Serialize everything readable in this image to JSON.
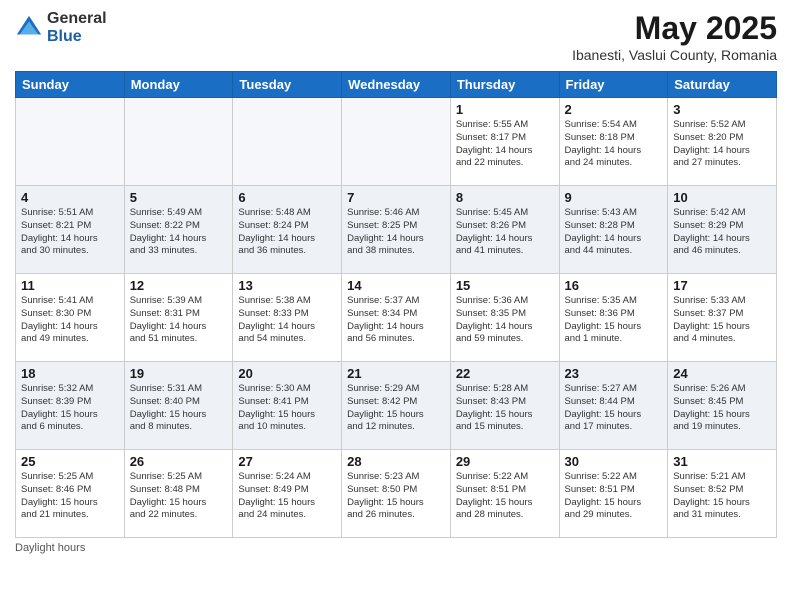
{
  "logo": {
    "general": "General",
    "blue": "Blue"
  },
  "header": {
    "month": "May 2025",
    "location": "Ibanesti, Vaslui County, Romania"
  },
  "days": [
    "Sunday",
    "Monday",
    "Tuesday",
    "Wednesday",
    "Thursday",
    "Friday",
    "Saturday"
  ],
  "footer": {
    "note": "Daylight hours"
  },
  "weeks": [
    [
      {
        "day": "",
        "content": ""
      },
      {
        "day": "",
        "content": ""
      },
      {
        "day": "",
        "content": ""
      },
      {
        "day": "",
        "content": ""
      },
      {
        "day": "1",
        "content": "Sunrise: 5:55 AM\nSunset: 8:17 PM\nDaylight: 14 hours\nand 22 minutes."
      },
      {
        "day": "2",
        "content": "Sunrise: 5:54 AM\nSunset: 8:18 PM\nDaylight: 14 hours\nand 24 minutes."
      },
      {
        "day": "3",
        "content": "Sunrise: 5:52 AM\nSunset: 8:20 PM\nDaylight: 14 hours\nand 27 minutes."
      }
    ],
    [
      {
        "day": "4",
        "content": "Sunrise: 5:51 AM\nSunset: 8:21 PM\nDaylight: 14 hours\nand 30 minutes."
      },
      {
        "day": "5",
        "content": "Sunrise: 5:49 AM\nSunset: 8:22 PM\nDaylight: 14 hours\nand 33 minutes."
      },
      {
        "day": "6",
        "content": "Sunrise: 5:48 AM\nSunset: 8:24 PM\nDaylight: 14 hours\nand 36 minutes."
      },
      {
        "day": "7",
        "content": "Sunrise: 5:46 AM\nSunset: 8:25 PM\nDaylight: 14 hours\nand 38 minutes."
      },
      {
        "day": "8",
        "content": "Sunrise: 5:45 AM\nSunset: 8:26 PM\nDaylight: 14 hours\nand 41 minutes."
      },
      {
        "day": "9",
        "content": "Sunrise: 5:43 AM\nSunset: 8:28 PM\nDaylight: 14 hours\nand 44 minutes."
      },
      {
        "day": "10",
        "content": "Sunrise: 5:42 AM\nSunset: 8:29 PM\nDaylight: 14 hours\nand 46 minutes."
      }
    ],
    [
      {
        "day": "11",
        "content": "Sunrise: 5:41 AM\nSunset: 8:30 PM\nDaylight: 14 hours\nand 49 minutes."
      },
      {
        "day": "12",
        "content": "Sunrise: 5:39 AM\nSunset: 8:31 PM\nDaylight: 14 hours\nand 51 minutes."
      },
      {
        "day": "13",
        "content": "Sunrise: 5:38 AM\nSunset: 8:33 PM\nDaylight: 14 hours\nand 54 minutes."
      },
      {
        "day": "14",
        "content": "Sunrise: 5:37 AM\nSunset: 8:34 PM\nDaylight: 14 hours\nand 56 minutes."
      },
      {
        "day": "15",
        "content": "Sunrise: 5:36 AM\nSunset: 8:35 PM\nDaylight: 14 hours\nand 59 minutes."
      },
      {
        "day": "16",
        "content": "Sunrise: 5:35 AM\nSunset: 8:36 PM\nDaylight: 15 hours\nand 1 minute."
      },
      {
        "day": "17",
        "content": "Sunrise: 5:33 AM\nSunset: 8:37 PM\nDaylight: 15 hours\nand 4 minutes."
      }
    ],
    [
      {
        "day": "18",
        "content": "Sunrise: 5:32 AM\nSunset: 8:39 PM\nDaylight: 15 hours\nand 6 minutes."
      },
      {
        "day": "19",
        "content": "Sunrise: 5:31 AM\nSunset: 8:40 PM\nDaylight: 15 hours\nand 8 minutes."
      },
      {
        "day": "20",
        "content": "Sunrise: 5:30 AM\nSunset: 8:41 PM\nDaylight: 15 hours\nand 10 minutes."
      },
      {
        "day": "21",
        "content": "Sunrise: 5:29 AM\nSunset: 8:42 PM\nDaylight: 15 hours\nand 12 minutes."
      },
      {
        "day": "22",
        "content": "Sunrise: 5:28 AM\nSunset: 8:43 PM\nDaylight: 15 hours\nand 15 minutes."
      },
      {
        "day": "23",
        "content": "Sunrise: 5:27 AM\nSunset: 8:44 PM\nDaylight: 15 hours\nand 17 minutes."
      },
      {
        "day": "24",
        "content": "Sunrise: 5:26 AM\nSunset: 8:45 PM\nDaylight: 15 hours\nand 19 minutes."
      }
    ],
    [
      {
        "day": "25",
        "content": "Sunrise: 5:25 AM\nSunset: 8:46 PM\nDaylight: 15 hours\nand 21 minutes."
      },
      {
        "day": "26",
        "content": "Sunrise: 5:25 AM\nSunset: 8:48 PM\nDaylight: 15 hours\nand 22 minutes."
      },
      {
        "day": "27",
        "content": "Sunrise: 5:24 AM\nSunset: 8:49 PM\nDaylight: 15 hours\nand 24 minutes."
      },
      {
        "day": "28",
        "content": "Sunrise: 5:23 AM\nSunset: 8:50 PM\nDaylight: 15 hours\nand 26 minutes."
      },
      {
        "day": "29",
        "content": "Sunrise: 5:22 AM\nSunset: 8:51 PM\nDaylight: 15 hours\nand 28 minutes."
      },
      {
        "day": "30",
        "content": "Sunrise: 5:22 AM\nSunset: 8:51 PM\nDaylight: 15 hours\nand 29 minutes."
      },
      {
        "day": "31",
        "content": "Sunrise: 5:21 AM\nSunset: 8:52 PM\nDaylight: 15 hours\nand 31 minutes."
      }
    ]
  ]
}
